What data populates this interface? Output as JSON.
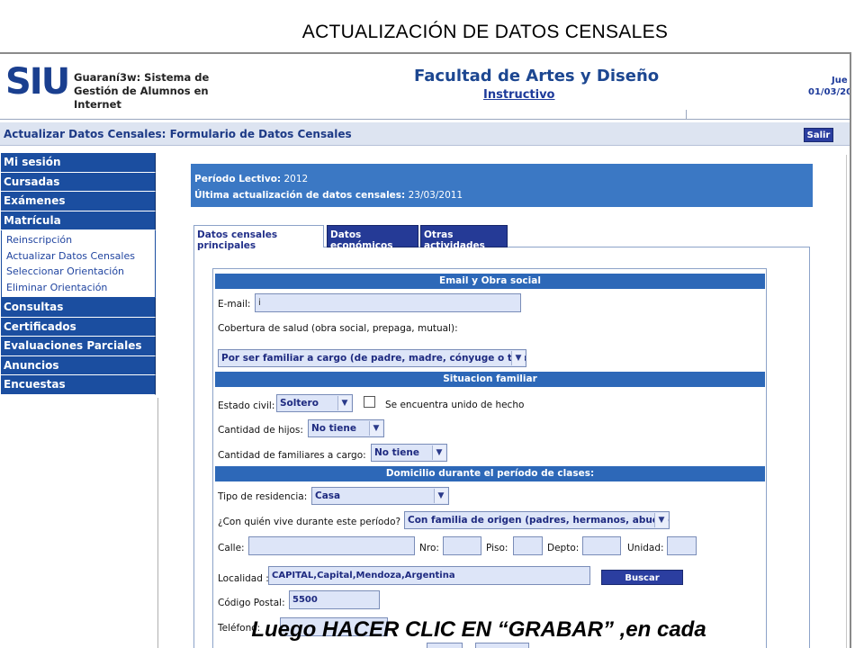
{
  "slide_title": "ACTUALIZACIÓN DE DATOS CENSALES",
  "header": {
    "logo": "SIU",
    "system_name": "Guaraní3w: Sistema de Gestión de Alumnos en Internet",
    "faculty": "Facultad de Artes y Diseño",
    "instructivo_link": "Instructivo",
    "date_day": "Jue",
    "date": "01/03/20"
  },
  "titlebar": {
    "title": "Actualizar Datos Censales: Formulario de Datos Censales",
    "salir_label": "Salir"
  },
  "menu": {
    "items": [
      "Mi sesión",
      "Cursadas",
      "Exámenes",
      "Matrícula"
    ],
    "submenu": [
      "Reinscripción",
      "Actualizar Datos Censales",
      "Seleccionar Orientación",
      "Eliminar Orientación"
    ],
    "items_after": [
      "Consultas",
      "Certificados",
      "Evaluaciones Parciales",
      "Anuncios",
      "Encuestas"
    ]
  },
  "info": {
    "periodo_label": "Período Lectivo:",
    "periodo_value": "2012",
    "actualizacion_label": "Última actualización de datos censales:",
    "actualizacion_value": "23/03/2011"
  },
  "tabs": [
    "Datos censales principales",
    "Datos económicos",
    "Otras actividades"
  ],
  "form": {
    "sec_email": "Email y Obra social",
    "email_label": "E-mail:",
    "email_value": "i",
    "cobertura_label": "Cobertura de salud (obra social, prepaga, mutual):",
    "cobertura_value": "Por ser familiar a cargo (de padre, madre, cónyuge o tutor)",
    "sec_familiar": "Situacion familiar",
    "estado_label": "Estado civil:",
    "estado_value": "Soltero",
    "unido_label": "Se encuentra unido de hecho",
    "hijos_label": "Cantidad de hijos:",
    "hijos_value": "No tiene",
    "familiares_label": "Cantidad de familiares a cargo:",
    "familiares_value": "No tiene",
    "sec_domicilio": "Domicilio durante el período de clases:",
    "residencia_label": "Tipo de residencia:",
    "residencia_value": "Casa",
    "convive_label": "¿Con quién vive durante este período?",
    "convive_value": "Con familia de origen (padres, hermanos, abuelos)",
    "calle_label": "Calle:",
    "nro_label": "Nro:",
    "piso_label": "Piso:",
    "depto_label": "Depto:",
    "unidad_label": "Unidad:",
    "localidad_label": "Localidad :",
    "localidad_value": "CAPITAL,Capital,Mendoza,Argentina",
    "buscar_label": "Buscar Localidad",
    "cp_label": "Código Postal:",
    "cp_value": "5500",
    "telefono_label": "Teléfono:"
  },
  "caption": "Luego HACER CLIC EN “GRABAR” ,en cada"
}
